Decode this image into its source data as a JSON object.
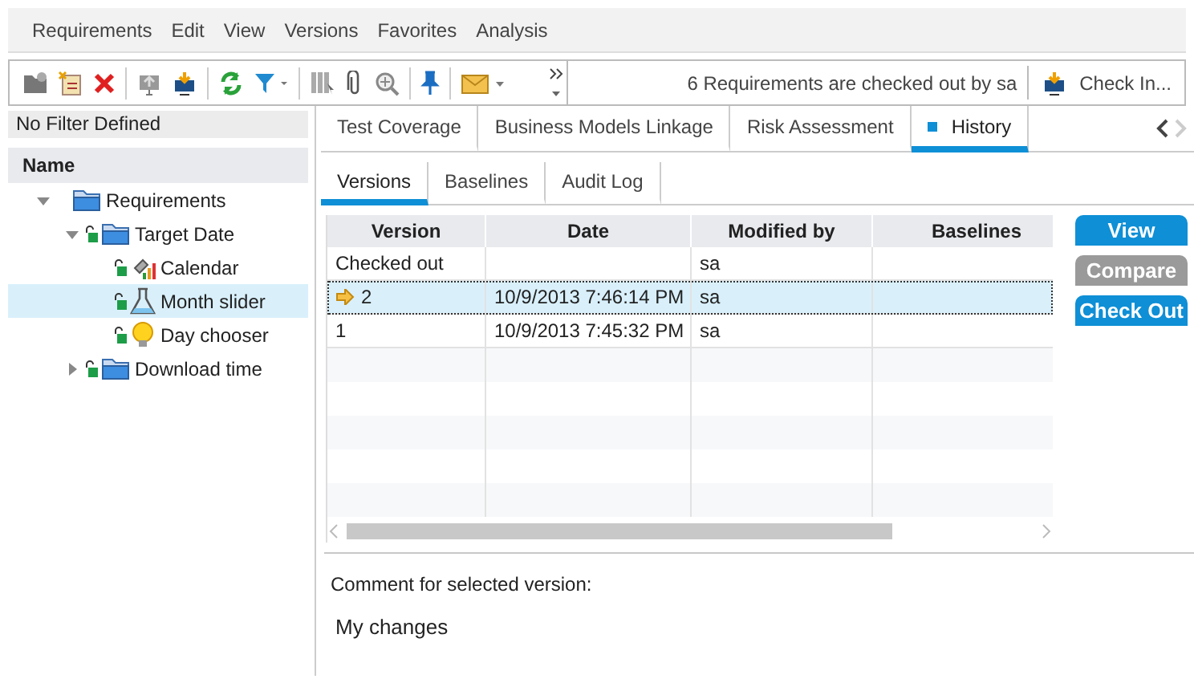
{
  "menu": [
    "Requirements",
    "Edit",
    "View",
    "Versions",
    "Favorites",
    "Analysis"
  ],
  "toolbar": {
    "status": "6 Requirements are checked out by sa",
    "check_in": "Check In..."
  },
  "filter": "No Filter Defined",
  "tree": {
    "column": "Name",
    "items": [
      {
        "label": "Requirements",
        "kind": "folder",
        "checked_out": false,
        "expanded": true,
        "selected": false,
        "children": [
          {
            "label": "Target Date",
            "kind": "folder",
            "checked_out": true,
            "expanded": true,
            "selected": false,
            "children": [
              {
                "label": "Calendar",
                "kind": "chart",
                "checked_out": true,
                "selected": false
              },
              {
                "label": "Month slider",
                "kind": "flask",
                "checked_out": true,
                "selected": true
              },
              {
                "label": "Day chooser",
                "kind": "bulb",
                "checked_out": true,
                "selected": false
              }
            ]
          },
          {
            "label": "Download time",
            "kind": "folder",
            "checked_out": true,
            "expanded": false,
            "selected": false
          }
        ]
      }
    ]
  },
  "tabs": [
    {
      "label": "Test Coverage",
      "selected": false
    },
    {
      "label": "Business Models Linkage",
      "selected": false
    },
    {
      "label": "Risk Assessment",
      "selected": false
    },
    {
      "label": "History",
      "selected": true
    }
  ],
  "subtabs": [
    {
      "label": "Versions",
      "selected": true
    },
    {
      "label": "Baselines",
      "selected": false
    },
    {
      "label": "Audit Log",
      "selected": false
    }
  ],
  "table": {
    "columns": [
      "Version",
      "Date",
      "Modified by",
      "Baselines"
    ],
    "rows": [
      {
        "version": "Checked out",
        "modified_by": "sa",
        "selected": false,
        "current": false
      },
      {
        "version": "2",
        "date": "10/9/2013 7:46:14 PM",
        "modified_by": "sa",
        "selected": true,
        "current": true
      },
      {
        "version": "1",
        "date": "10/9/2013 7:45:32 PM",
        "modified_by": "sa",
        "selected": false,
        "current": false
      }
    ]
  },
  "actions": [
    {
      "label": "View",
      "disabled": false
    },
    {
      "label": "Compare",
      "disabled": true
    },
    {
      "label": "Check Out",
      "disabled": false
    }
  ],
  "comment": {
    "label": "Comment for selected version:",
    "value": "My changes"
  }
}
